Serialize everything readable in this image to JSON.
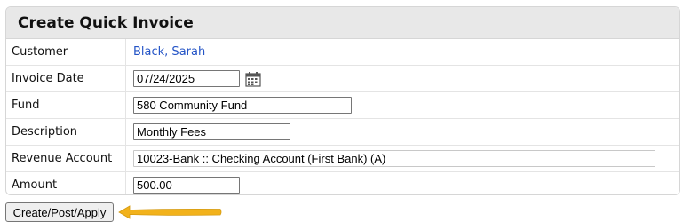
{
  "panel": {
    "title": "Create Quick Invoice"
  },
  "fields": {
    "customer": {
      "label": "Customer",
      "value": "Black, Sarah"
    },
    "invoice_date": {
      "label": "Invoice Date",
      "value": "07/24/2025"
    },
    "fund": {
      "label": "Fund",
      "value": "580 Community Fund"
    },
    "description": {
      "label": "Description",
      "value": "Monthly Fees"
    },
    "revenue_account": {
      "label": "Revenue Account",
      "value": "10023-Bank :: Checking Account (First Bank) (A)"
    },
    "amount": {
      "label": "Amount",
      "value": "500.00"
    }
  },
  "actions": {
    "submit_label": "Create/Post/Apply"
  },
  "icons": {
    "calendar": "calendar-icon",
    "pointer": "arrow-left-icon"
  },
  "colors": {
    "link": "#2454c6",
    "arrow": "#f2b21b",
    "header_bg": "#e8e8e8"
  }
}
